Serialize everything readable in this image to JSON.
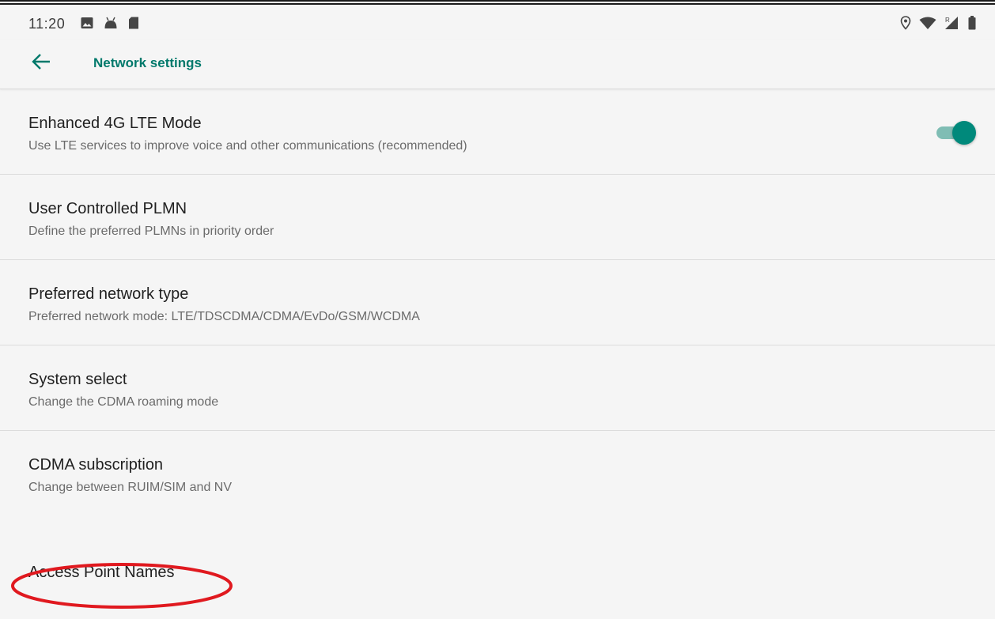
{
  "status_bar": {
    "time": "11:20",
    "left_icons": [
      "image-icon",
      "android-icon",
      "sd-card-icon"
    ],
    "right_icons": [
      "location-icon",
      "wifi-icon",
      "signal-roaming-icon",
      "battery-icon"
    ],
    "roaming_indicator": "R"
  },
  "app_bar": {
    "back_icon": "arrow-back-icon",
    "title": "Network settings"
  },
  "settings": [
    {
      "title": "Enhanced 4G LTE Mode",
      "summary": "Use LTE services to improve voice and other communications (recommended)",
      "toggle_on": true
    },
    {
      "title": "User Controlled PLMN",
      "summary": "Define the preferred PLMNs in priority order"
    },
    {
      "title": "Preferred network type",
      "summary": "Preferred network mode: LTE/TDSCDMA/CDMA/EvDo/GSM/WCDMA"
    },
    {
      "title": "System select",
      "summary": "Change the CDMA roaming mode"
    },
    {
      "title": "CDMA subscription",
      "summary": "Change between RUIM/SIM and NV"
    }
  ],
  "access_point_names": {
    "title": "Access Point Names",
    "highlight": "red-ellipse-annotation"
  },
  "colors": {
    "accent": "#00796b",
    "toggle_thumb": "#00897b",
    "toggle_track": "#7fbdb4",
    "background": "#f5f5f5",
    "annotation": "#e0191f"
  }
}
